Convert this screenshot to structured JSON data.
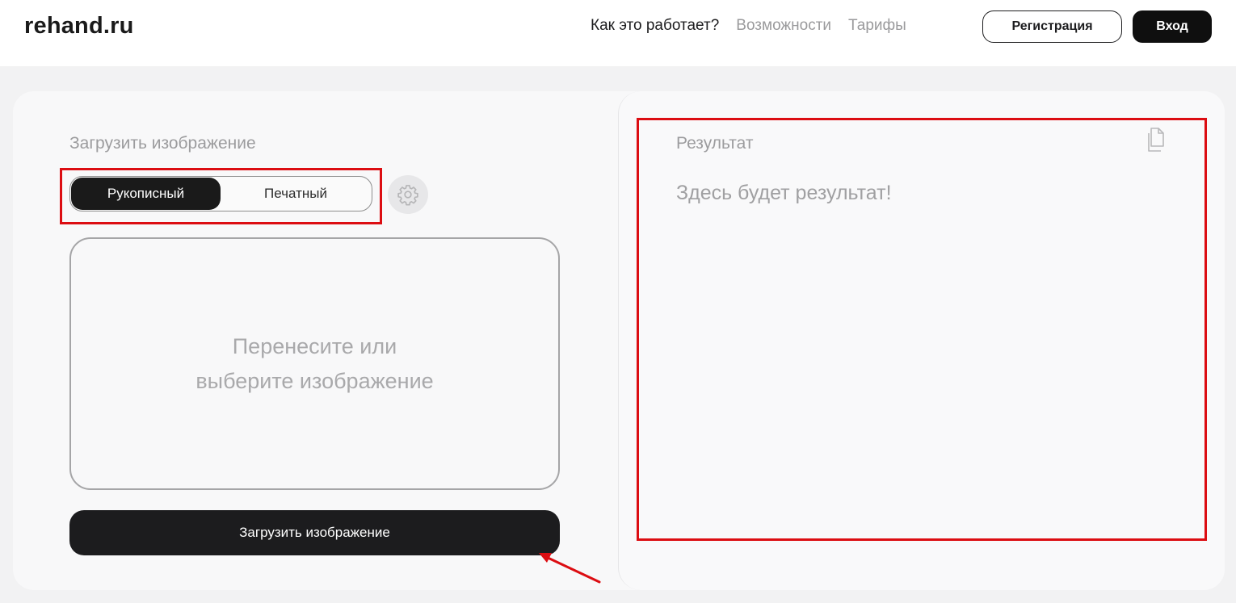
{
  "header": {
    "logo": "rehand.ru",
    "nav": [
      {
        "label": "Как это работает?",
        "active": true
      },
      {
        "label": "Возможности",
        "active": false
      },
      {
        "label": "Тарифы",
        "active": false
      }
    ],
    "register_label": "Регистрация",
    "login_label": "Вход"
  },
  "upload": {
    "title": "Загрузить изображение",
    "modes": {
      "handwritten": "Рукописный",
      "printed": "Печатный",
      "selected": "handwritten"
    },
    "dropzone_line1": "Перенесите или",
    "dropzone_line2": "выберите изображение",
    "button_label": "Загрузить изображение"
  },
  "result": {
    "title": "Результат",
    "placeholder": "Здесь будет результат!"
  },
  "icons": {
    "settings": "gear-icon",
    "copy": "copy-icon"
  },
  "colors": {
    "accent_dark": "#1a1a1a",
    "annotation_red": "#dc0d12",
    "muted_text": "#9c9c9e"
  }
}
